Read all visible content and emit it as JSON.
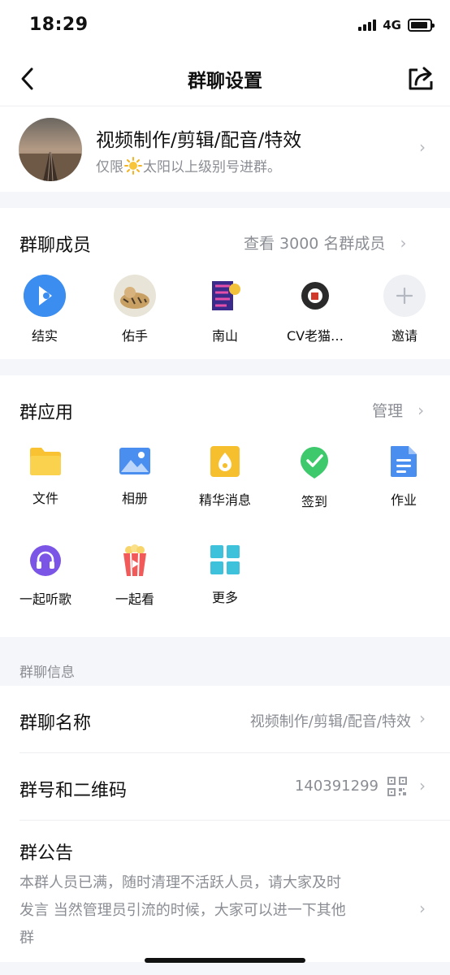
{
  "status_bar": {
    "time": "18:29",
    "network": "4G"
  },
  "nav": {
    "title": "群聊设置"
  },
  "group": {
    "name": "视频制作/剪辑/配音/特效",
    "desc_prefix": "仅限",
    "desc_suffix": "太阳以上级别号进群。"
  },
  "members": {
    "title": "群聊成员",
    "view_all": "查看 3000 名群成员",
    "items": [
      {
        "name": "结实"
      },
      {
        "name": "佑手"
      },
      {
        "name": "南山"
      },
      {
        "name": "CV老猫…"
      },
      {
        "name": "邀请"
      }
    ]
  },
  "apps": {
    "title": "群应用",
    "manage": "管理",
    "items": [
      {
        "label": "文件",
        "icon": "folder-icon"
      },
      {
        "label": "相册",
        "icon": "album-icon"
      },
      {
        "label": "精华消息",
        "icon": "essence-icon"
      },
      {
        "label": "签到",
        "icon": "checkin-icon"
      },
      {
        "label": "作业",
        "icon": "homework-icon"
      },
      {
        "label": "一起听歌",
        "icon": "headphones-icon"
      },
      {
        "label": "一起看",
        "icon": "popcorn-icon"
      },
      {
        "label": "更多",
        "icon": "more-grid-icon"
      }
    ]
  },
  "info": {
    "section_title": "群聊信息",
    "name_row": {
      "label": "群聊名称",
      "value": "视频制作/剪辑/配音/特效"
    },
    "id_row": {
      "label": "群号和二维码",
      "value": "140391299"
    },
    "notice": {
      "label": "群公告",
      "line1": "本群人员已满，随时清理不活跃人员，请大家及时",
      "line2": "发言 当然管理员引流的时候，大家可以进一下其他",
      "line3": "群"
    }
  },
  "colors": {
    "accent": "#2d8cf0",
    "muted": "#8a8d93",
    "bg": "#f5f6fa"
  }
}
